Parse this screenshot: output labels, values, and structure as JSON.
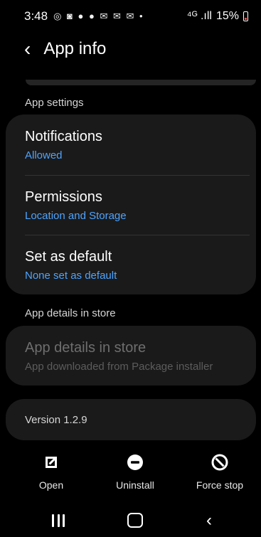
{
  "status_bar": {
    "time": "3:48",
    "notification_icons": "◎ ◙ ● ● ✉ ✉ ✉ •",
    "signal": "⁴ᴳ .ıll",
    "battery_text": "15%"
  },
  "header": {
    "back_icon": "‹",
    "title": "App info"
  },
  "sections": {
    "app_settings": "App settings",
    "app_details_in_store": "App details in store"
  },
  "settings": [
    {
      "title": "Notifications",
      "subtitle": "Allowed"
    },
    {
      "title": "Permissions",
      "subtitle": "Location and Storage"
    },
    {
      "title": "Set as default",
      "subtitle": "None set as default"
    }
  ],
  "store": {
    "title": "App details in store",
    "subtitle": "App downloaded from Package installer"
  },
  "version": "Version 1.2.9",
  "actions": [
    {
      "icon": "open-icon",
      "label": "Open"
    },
    {
      "icon": "uninstall-icon",
      "label": "Uninstall"
    },
    {
      "icon": "force-stop-icon",
      "label": "Force stop"
    }
  ],
  "colors": {
    "background": "#000000",
    "card": "#1a1a1a",
    "link_blue": "#4ea4ff",
    "disabled_text": "#6e6e6e",
    "battery_low": "#e24c4c"
  }
}
